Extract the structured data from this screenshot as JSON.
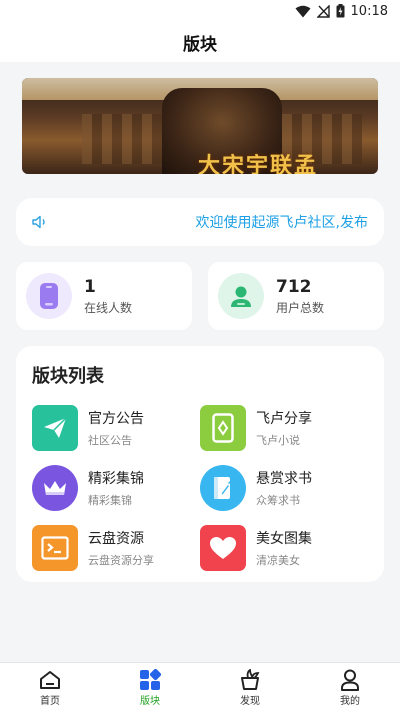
{
  "status": {
    "time": "10:18"
  },
  "title": "版块",
  "banner": {
    "text": "大宋宇联孟"
  },
  "notice": {
    "text": "欢迎使用起源飞卢社区,发布"
  },
  "stats": [
    {
      "value": "1",
      "label": "在线人数",
      "icon": "phone-icon",
      "color": "#9b7cf0",
      "bg": "#efe9fd"
    },
    {
      "value": "712",
      "label": "用户总数",
      "icon": "user-icon",
      "color": "#2bb673",
      "bg": "#dff5ea"
    }
  ],
  "boards": {
    "title": "版块列表",
    "items": [
      {
        "name": "官方公告",
        "sub": "社区公告",
        "icon": "paper-plane-icon",
        "color": "#27c19c"
      },
      {
        "name": "飞卢分享",
        "sub": "飞卢小说",
        "icon": "tablet-icon",
        "color": "#8ccd3f"
      },
      {
        "name": "精彩集锦",
        "sub": "精彩集锦",
        "icon": "crown-icon",
        "color": "#7a55e0"
      },
      {
        "name": "悬赏求书",
        "sub": "众筹求书",
        "icon": "book-pen-icon",
        "color": "#38b6ef"
      },
      {
        "name": "云盘资源",
        "sub": "云盘资源分享",
        "icon": "terminal-icon",
        "color": "#f5962a"
      },
      {
        "name": "美女图集",
        "sub": "清凉美女",
        "icon": "heart-icon",
        "color": "#f0434d"
      }
    ]
  },
  "tabs": [
    {
      "label": "首页",
      "icon": "home-icon"
    },
    {
      "label": "版块",
      "icon": "grid-icon",
      "active": true
    },
    {
      "label": "发现",
      "icon": "discover-icon"
    },
    {
      "label": "我的",
      "icon": "profile-icon"
    }
  ]
}
